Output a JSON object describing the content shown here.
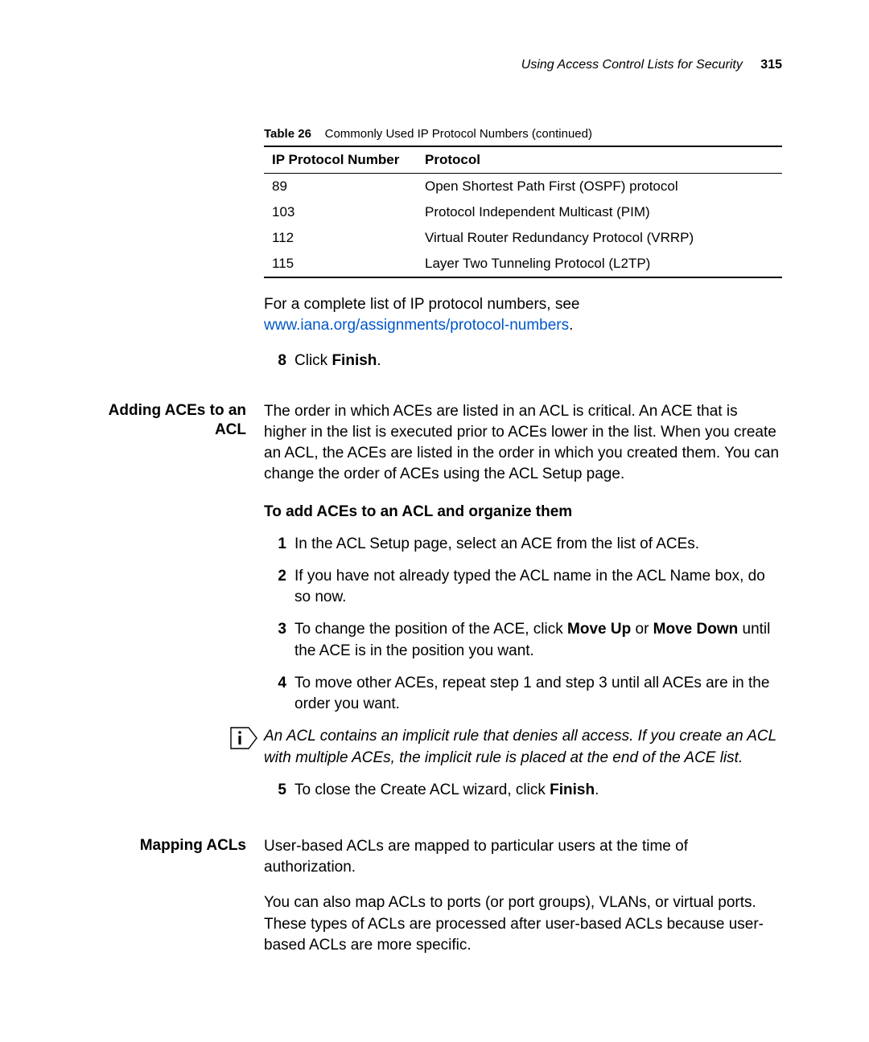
{
  "header": {
    "title": "Using Access Control Lists for Security",
    "page": "315"
  },
  "table": {
    "caption_label": "Table 26",
    "caption_text": "Commonly Used IP Protocol Numbers (continued)",
    "col1": "IP Protocol Number",
    "col2": "Protocol",
    "rows": [
      {
        "num": "89",
        "proto": "Open Shortest Path First (OSPF) protocol"
      },
      {
        "num": "103",
        "proto": "Protocol Independent Multicast (PIM)"
      },
      {
        "num": "112",
        "proto": "Virtual Router Redundancy Protocol (VRRP)"
      },
      {
        "num": "115",
        "proto": "Layer Two Tunneling Protocol (L2TP)"
      }
    ]
  },
  "pre_link_text": "For a complete list of IP protocol numbers, see ",
  "link_text": "www.iana.org/assignments/protocol-numbers",
  "post_link_text": ".",
  "step8_num": "8",
  "step8_a": "Click ",
  "step8_b": "Finish",
  "step8_c": ".",
  "sec1": {
    "heading": "Adding ACEs to an ACL",
    "intro": "The order in which ACEs are listed in an ACL is critical. An ACE that is higher in the list is executed prior to ACEs lower in the list. When you create an ACL, the ACEs are listed in the order in which you created them. You can change the order of ACEs using the ACL Setup page.",
    "subhead": "To add ACEs to an ACL and organize them",
    "s1_num": "1",
    "s1": "In the ACL Setup page, select an ACE from the list of ACEs.",
    "s2_num": "2",
    "s2": "If you have not already typed the ACL name in the ACL Name box, do so now.",
    "s3_num": "3",
    "s3_a": "To change the position of the ACE, click ",
    "s3_b": "Move Up",
    "s3_c": " or ",
    "s3_d": "Move Down",
    "s3_e": " until the ACE is in the position you want.",
    "s4_num": "4",
    "s4": "To move other ACEs, repeat step 1 and step 3 until all ACEs are in the order you want.",
    "note": "An ACL contains an implicit rule that denies all access. If you create an ACL with multiple ACEs, the implicit rule is placed at the end of the ACE list.",
    "s5_num": "5",
    "s5_a": "To close the Create ACL wizard, click ",
    "s5_b": "Finish",
    "s5_c": "."
  },
  "sec2": {
    "heading": "Mapping ACLs",
    "p1": "User-based ACLs are mapped to particular users at the time of authorization.",
    "p2": "You can also map ACLs to ports (or port groups), VLANs, or virtual ports. These types of ACLs are processed after user-based ACLs because user-based ACLs are more specific."
  }
}
